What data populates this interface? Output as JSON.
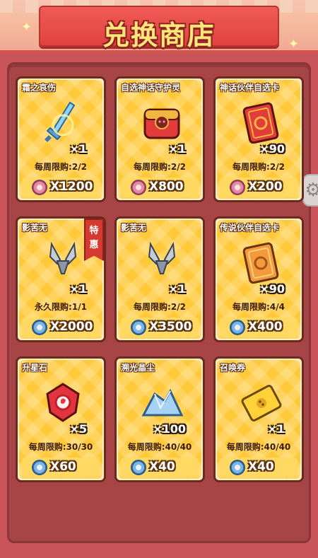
{
  "header": {
    "title": "兑换商店"
  },
  "colors": {
    "accent": "#e0433f",
    "card_bg": "#ffc93a",
    "panel": "#a74546"
  },
  "items": [
    {
      "name": "霜之哀伤",
      "icon": "ice-sword-icon",
      "qty": "×1",
      "limit": "每周限购:2/2",
      "currency": "pink-coin-icon",
      "price": "X1200"
    },
    {
      "name": "自选神话守护灵",
      "icon": "red-chest-icon",
      "qty": "×1",
      "limit": "每周限购:2/2",
      "currency": "pink-coin-icon",
      "price": "X800"
    },
    {
      "name": "神话伙伴自选卡",
      "icon": "red-card-icon",
      "qty": "×90",
      "limit": "每周限购:2/2",
      "currency": "pink-coin-icon",
      "price": "X200"
    },
    {
      "name": "影苦无",
      "icon": "kunai-icon",
      "qty": "×1",
      "limit": "永久限购:1/1",
      "currency": "blue-coin-icon",
      "price": "X2000",
      "tag": "特惠"
    },
    {
      "name": "影苦无",
      "icon": "kunai-icon",
      "qty": "×1",
      "limit": "每周限购:2/2",
      "currency": "blue-coin-icon",
      "price": "X3500"
    },
    {
      "name": "传说伙伴自选卡",
      "icon": "orange-card-icon",
      "qty": "×90",
      "limit": "每周限购:4/4",
      "currency": "blue-coin-icon",
      "price": "X400"
    },
    {
      "name": "升星石",
      "icon": "star-stone-icon",
      "qty": "×5",
      "limit": "每周限购:30/30",
      "currency": "blue-coin-icon",
      "price": "X60"
    },
    {
      "name": "溯光晶尘",
      "icon": "crystal-dust-icon",
      "qty": "×100",
      "limit": "每周限购:40/40",
      "currency": "blue-coin-icon",
      "price": "X40"
    },
    {
      "name": "召唤券",
      "icon": "summon-ticket-icon",
      "qty": "×1",
      "limit": "每周限购:40/40",
      "currency": "blue-coin-icon",
      "price": "X40"
    }
  ],
  "side": {
    "icon": "gear-icon"
  }
}
